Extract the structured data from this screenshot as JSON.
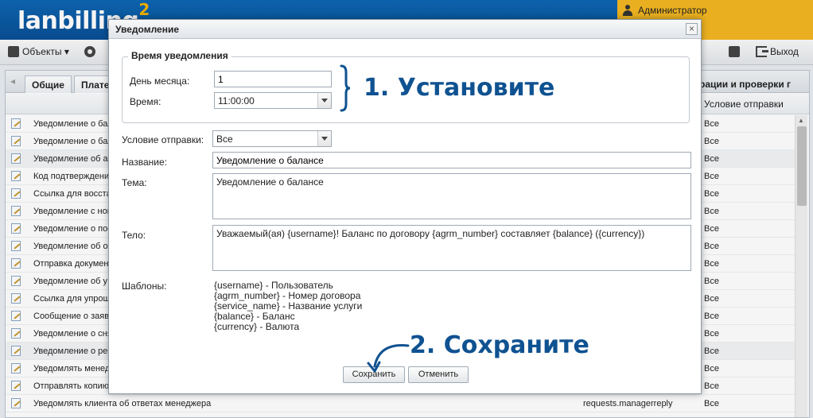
{
  "banner": {
    "logo_text": "lanbilling",
    "logo_sup": "2",
    "admin_label": "Администратор"
  },
  "toolbar": {
    "objects_label": "Объекты ▾",
    "exit_label": "Выход"
  },
  "tabs": [
    "Общие",
    "Плате"
  ],
  "tab_right_label": "рации и проверки г",
  "grid": {
    "header_right": "Условие отправки",
    "rows": [
      {
        "name": "Уведомление о бал",
        "cond": "Все"
      },
      {
        "name": "Уведомление о бал",
        "cond": "Все"
      },
      {
        "name": "Уведомление об ак",
        "cond": "Все"
      },
      {
        "name": "Код подтверждени",
        "cond": "Все"
      },
      {
        "name": "Ссылка для восста",
        "cond": "Все"
      },
      {
        "name": "Уведомление с нов",
        "cond": "Все"
      },
      {
        "name": "Уведомление о пос",
        "cond": "Все"
      },
      {
        "name": "Уведомление об о",
        "cond": "Все"
      },
      {
        "name": "Отправка докумен",
        "cond": "Все"
      },
      {
        "name": "Уведомление об у",
        "cond": "Все"
      },
      {
        "name": "Ссылка для упрощ",
        "cond": "Все"
      },
      {
        "name": "Сообщение о заяв",
        "cond": "Все"
      },
      {
        "name": "Уведомление о сня",
        "cond": "Все"
      },
      {
        "name": "Уведомление о рег",
        "cond": "Все"
      },
      {
        "name": "Уведомлять менед",
        "cond": "Все"
      },
      {
        "name": "Отправлять копию",
        "cond": "Все"
      },
      {
        "name": "Уведомлять клиента об ответах менеджера",
        "code": "requests.managerreply",
        "cond": "Все"
      }
    ]
  },
  "modal": {
    "title": "Уведомление",
    "close": "×",
    "fieldset_legend": "Время уведомления",
    "day_label": "День месяца:",
    "day_value": "1",
    "time_label": "Время:",
    "time_value": "11:00:00",
    "condition_label": "Условие отправки:",
    "condition_value": "Все",
    "name_label": "Название:",
    "name_value": "Уведомление о балансе",
    "subject_label": "Тема:",
    "subject_value": "Уведомление о балансе",
    "body_label": "Тело:",
    "body_value": "Уважаемый(ая) {username}! Баланс по договору {agrm_number} составляет {balance} ({currency})",
    "templates_label": "Шаблоны:",
    "templates": [
      "{username} - Пользователь",
      "{agrm_number} - Номер договора",
      "{service_name} - Название услуги",
      "{balance} - Баланс",
      "{currency} - Валюта"
    ],
    "save_label": "Сохранить",
    "cancel_label": "Отменить"
  },
  "annotations": {
    "step1": "1. Установите",
    "step2": "2. Сохраните",
    "color": "#0f5291"
  }
}
